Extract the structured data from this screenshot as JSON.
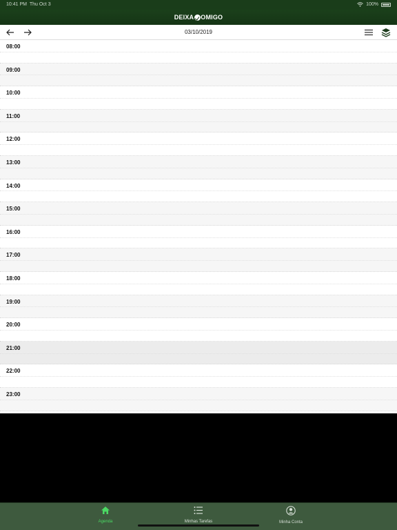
{
  "status_bar": {
    "time": "10:41 PM",
    "day": "Thu Oct 3",
    "battery": "100%"
  },
  "header": {
    "title_left": "DEIXA",
    "title_right": "OMIGO"
  },
  "navbar": {
    "date": "03/10/2019"
  },
  "schedule": {
    "hours": [
      "08:00",
      "09:00",
      "10:00",
      "11:00",
      "12:00",
      "13:00",
      "14:00",
      "15:00",
      "16:00",
      "17:00",
      "18:00",
      "19:00",
      "20:00",
      "21:00",
      "22:00",
      "23:00"
    ]
  },
  "tabs": [
    {
      "label": "Agenda",
      "icon": "home-icon",
      "active": true
    },
    {
      "label": "Minhas Tarefas",
      "icon": "list-icon",
      "active": false
    },
    {
      "label": "Minha Conta",
      "icon": "account-icon",
      "active": false
    }
  ],
  "colors": {
    "header_green": "#153515",
    "tab_bar": "#3e5a3e",
    "active_tab": "#4cd964",
    "inactive_tab": "#d6ded6"
  }
}
